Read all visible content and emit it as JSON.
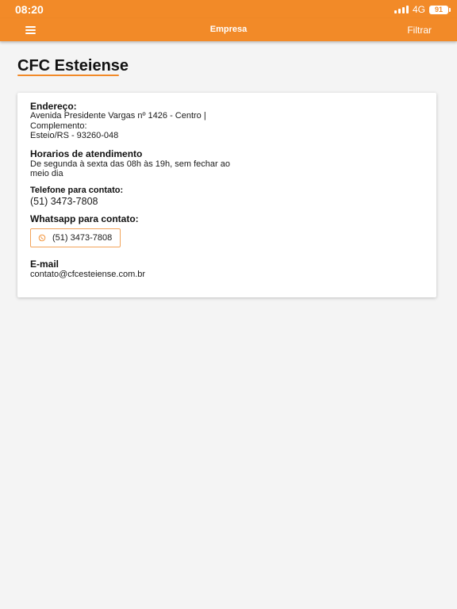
{
  "status_bar": {
    "time": "08:20",
    "network": "4G",
    "battery": "91"
  },
  "app_bar": {
    "menu_icon": "hamburger-menu-icon",
    "title": "Empresa",
    "filter_label": "Filtrar"
  },
  "company": {
    "name": "CFC Esteiense"
  },
  "details": {
    "address_label": "Endereço:",
    "address_line": "Avenida Presidente Vargas nº 1426 - Centro |",
    "complement_label": "Complemento:",
    "city_line": "Esteio/RS - 93260-048",
    "hours_label": "Horarios de atendimento",
    "hours_line1": "De segunda à sexta das 08h às 19h, sem fechar ao",
    "hours_line2": "meio dia",
    "phone_label": "Telefone para contato:",
    "phone_value": "(51) 3473-7808",
    "whatsapp_label": "Whatsapp para contato:",
    "whatsapp_value": "(51) 3473-7808",
    "whatsapp_icon": "whatsapp-icon",
    "email_label": "E-mail",
    "email_value": "contato@cfcesteiense.com.br"
  },
  "colors": {
    "accent": "#f28a28",
    "background": "#f4f4f4",
    "card": "#ffffff"
  }
}
